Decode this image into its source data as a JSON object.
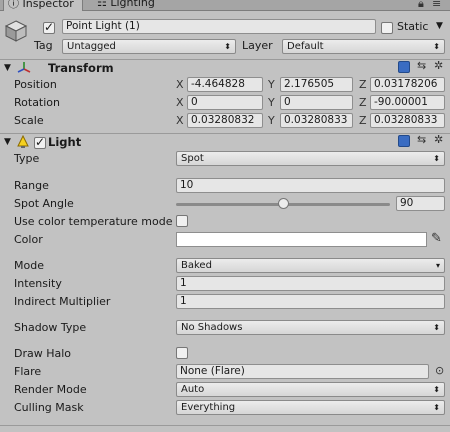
{
  "tabs": [
    {
      "label": "Inspector"
    },
    {
      "label": "Lighting"
    }
  ],
  "object": {
    "name": "Point Light (1)",
    "static_label": "Static",
    "tag_label": "Tag",
    "tag_value": "Untagged",
    "layer_label": "Layer",
    "layer_value": "Default"
  },
  "transform": {
    "title": "Transform",
    "position_label": "Position",
    "rotation_label": "Rotation",
    "scale_label": "Scale",
    "position": {
      "x": "-4.464828",
      "y": "2.176505",
      "z": "0.03178206"
    },
    "rotation": {
      "x": "0",
      "y": "0",
      "z": "-90.00001"
    },
    "scale": {
      "x": "0.03280832",
      "y": "0.03280833",
      "z": "0.03280833"
    },
    "axis": {
      "x": "X",
      "y": "Y",
      "z": "Z"
    }
  },
  "light": {
    "title": "Light",
    "type_label": "Type",
    "type_value": "Spot",
    "range_label": "Range",
    "range_value": "10",
    "spot_angle_label": "Spot Angle",
    "spot_angle_value": "90",
    "spot_angle_fraction": 0.5,
    "use_color_temp_label": "Use color temperature mode",
    "color_label": "Color",
    "color_value": "#ffffff",
    "mode_label": "Mode",
    "mode_value": "Baked",
    "intensity_label": "Intensity",
    "intensity_value": "1",
    "indirect_label": "Indirect Multiplier",
    "indirect_value": "1",
    "shadow_label": "Shadow Type",
    "shadow_value": "No Shadows",
    "draw_halo_label": "Draw Halo",
    "flare_label": "Flare",
    "flare_value": "None (Flare)",
    "render_mode_label": "Render Mode",
    "render_mode_value": "Auto",
    "culling_label": "Culling Mask",
    "culling_value": "Everything"
  }
}
